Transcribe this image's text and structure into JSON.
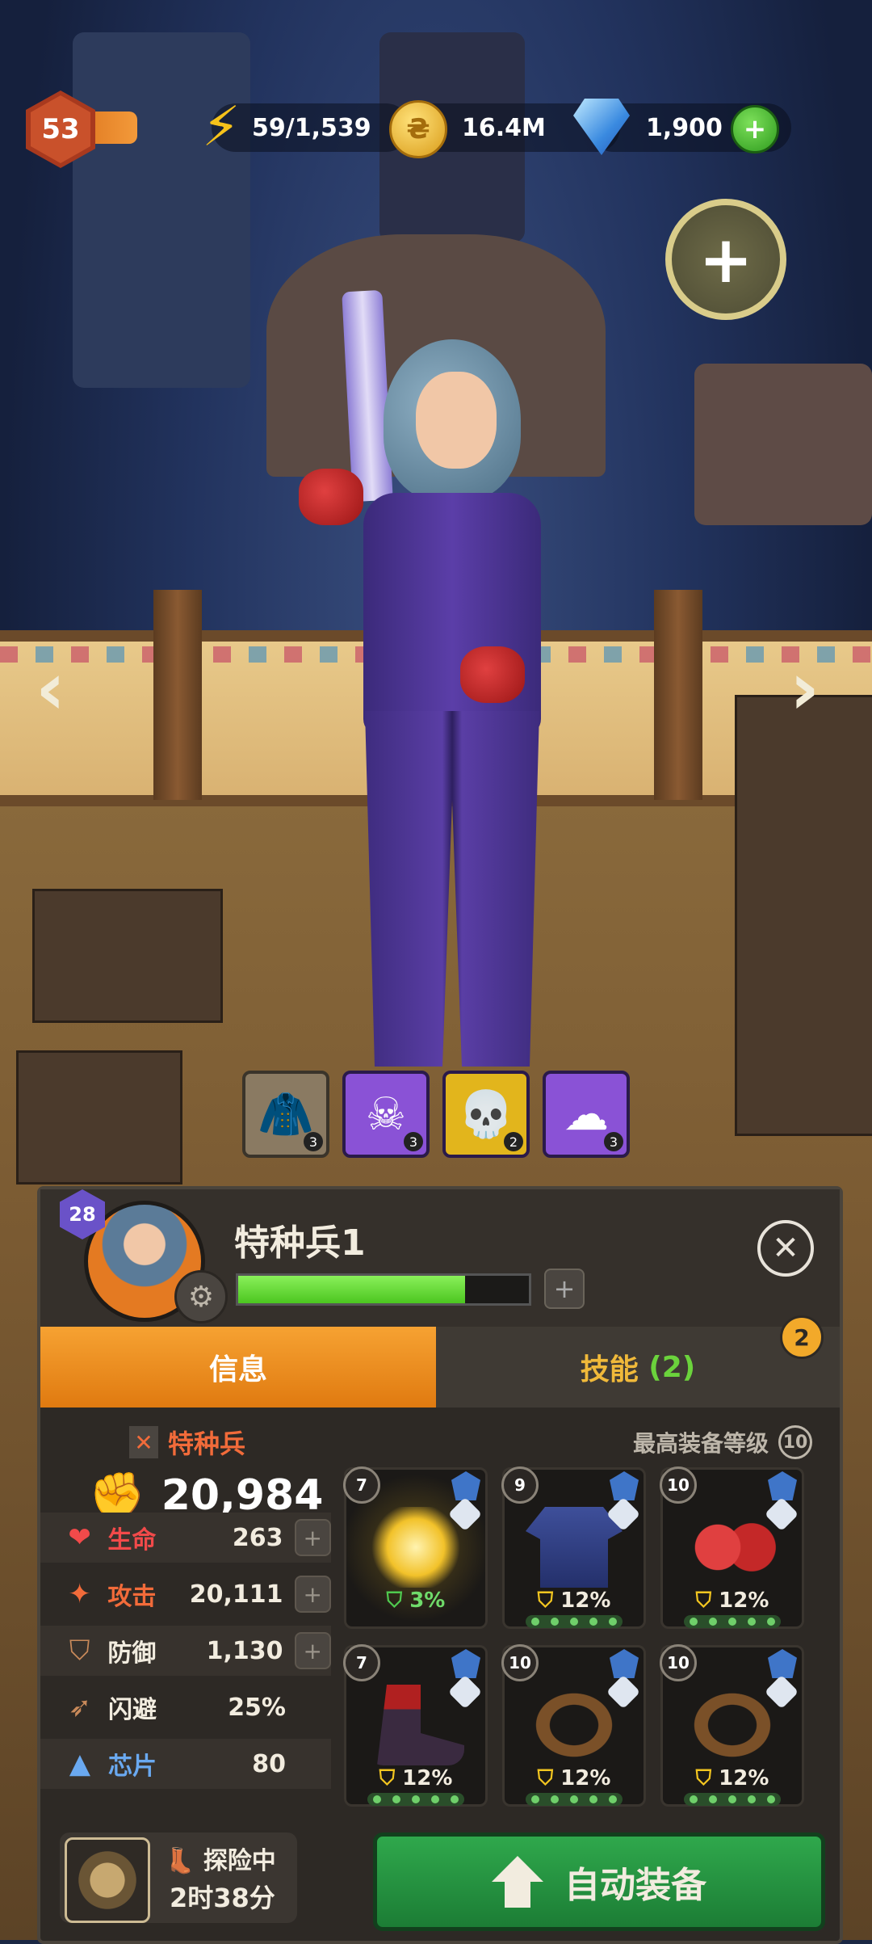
{
  "hud": {
    "player_level": "53",
    "energy": "59/1,539",
    "coins": "16.4M",
    "gems": "1,900",
    "coin_symbol": "₴"
  },
  "skills_bar": [
    {
      "icon": "hooded-figure-icon",
      "count": "3",
      "color": "#8a7a62"
    },
    {
      "icon": "skull-target-icon",
      "count": "3",
      "color": "#8a52d6"
    },
    {
      "icon": "reaper-icon",
      "count": "2",
      "color": "#e2b51c"
    },
    {
      "icon": "nuke-cloud-icon",
      "count": "3",
      "color": "#8a52d6"
    }
  ],
  "panel": {
    "hero_level": "28",
    "hero_name": "特种兵1",
    "hp_fill": 0.78,
    "tab_info": "信息",
    "tab_skill": "技能",
    "tab_skill_count": "(2)",
    "skill_badge": "2",
    "class_name": "特种兵",
    "power": "20,984",
    "max_equip_label": "最高装备等级",
    "max_equip_level": "10",
    "stats": [
      {
        "label": "生命",
        "value": "263",
        "color": "#f24a4a",
        "icon": "heart-icon",
        "plus": true
      },
      {
        "label": "攻击",
        "value": "20,111",
        "color": "#f26b3a",
        "icon": "attack-icon",
        "plus": true
      },
      {
        "label": "防御",
        "value": "1,130",
        "color": "#f2ecdf",
        "icon": "shield-icon",
        "plus": true
      },
      {
        "label": "闪避",
        "value": "25%",
        "color": "#f2ecdf",
        "icon": "dodge-icon",
        "plus": false
      },
      {
        "label": "芯片",
        "value": "80",
        "color": "#6aa9f0",
        "icon": "chip-icon",
        "plus": false
      }
    ],
    "equipment": [
      {
        "level": "7",
        "pct": "3%",
        "item": "pistol",
        "green": true,
        "dots": false
      },
      {
        "level": "9",
        "pct": "12%",
        "item": "shirt",
        "green": false,
        "dots": true
      },
      {
        "level": "10",
        "pct": "12%",
        "item": "gloves",
        "green": false,
        "dots": true
      },
      {
        "level": "7",
        "pct": "12%",
        "item": "boots",
        "green": false,
        "dots": true
      },
      {
        "level": "10",
        "pct": "12%",
        "item": "belt",
        "green": false,
        "dots": true
      },
      {
        "level": "10",
        "pct": "12%",
        "item": "belt",
        "green": false,
        "dots": true
      }
    ],
    "adventure_state": "探险中",
    "adventure_time": "2时38分",
    "auto_equip": "自动装备"
  }
}
